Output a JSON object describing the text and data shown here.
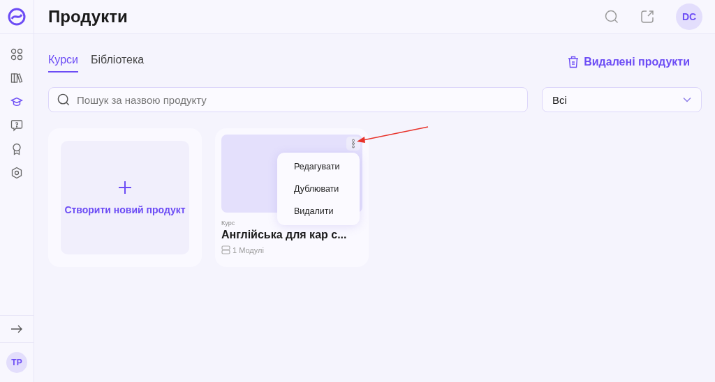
{
  "header": {
    "title": "Продукти",
    "avatar": "DC"
  },
  "sidebar": {
    "items": [
      {
        "kind": "grid",
        "selected": false
      },
      {
        "kind": "books",
        "selected": false
      },
      {
        "kind": "cap",
        "selected": true
      },
      {
        "kind": "question",
        "selected": false
      },
      {
        "kind": "award",
        "selected": false
      },
      {
        "kind": "settings",
        "selected": false
      }
    ],
    "avatar": "TP"
  },
  "tabs": [
    {
      "label": "Курси",
      "selected": true
    },
    {
      "label": "Бібліотека",
      "selected": false
    }
  ],
  "deleted_link": "Видалені продукти",
  "search": {
    "placeholder": "Пошук за назвою продукту"
  },
  "filter": {
    "value": "Всі"
  },
  "create_card": {
    "label": "Створити новий продукт"
  },
  "courses": [
    {
      "type": "Курс",
      "title": "Англійська для кар с...",
      "modules": "1 Модулі"
    }
  ],
  "menu": [
    "Редагувати",
    "Дублювати",
    "Видалити"
  ]
}
